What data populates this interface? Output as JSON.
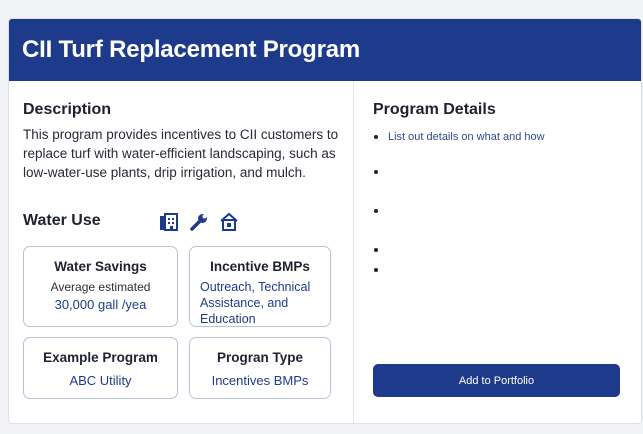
{
  "header": {
    "title": "CII Turf Replacement Program"
  },
  "description": {
    "heading": "Description",
    "text": "This program  provides incentives to CII customers to replace turf with water-efficient landscaping, such as low-water-use plants, drip irrigation, and mulch."
  },
  "water_use": {
    "heading": "Water Use",
    "icons": [
      "building-icon",
      "wrench-icon",
      "home-icon"
    ]
  },
  "tiles": {
    "water_savings": {
      "title": "Water Savings",
      "line1": "Average estimated",
      "line2": "30,000 gall /yea"
    },
    "incentive_bmps": {
      "title": "Incentive BMPs",
      "line1": "Outreach, Technical",
      "line2": "Assistance, and",
      "line3": "Education"
    },
    "example_program": {
      "title": "Example Program",
      "value": "ABC Utility"
    },
    "program_type": {
      "title": "Progran Type",
      "value": "Incentives BMPs"
    }
  },
  "program_details": {
    "heading": "Program Details",
    "items": [
      "List out details on what and how",
      "",
      "",
      "",
      ""
    ]
  },
  "actions": {
    "add_to_portfolio": "Add to Portfolio"
  },
  "colors": {
    "brand": "#1e3a8a",
    "border": "#b9c2d6"
  }
}
